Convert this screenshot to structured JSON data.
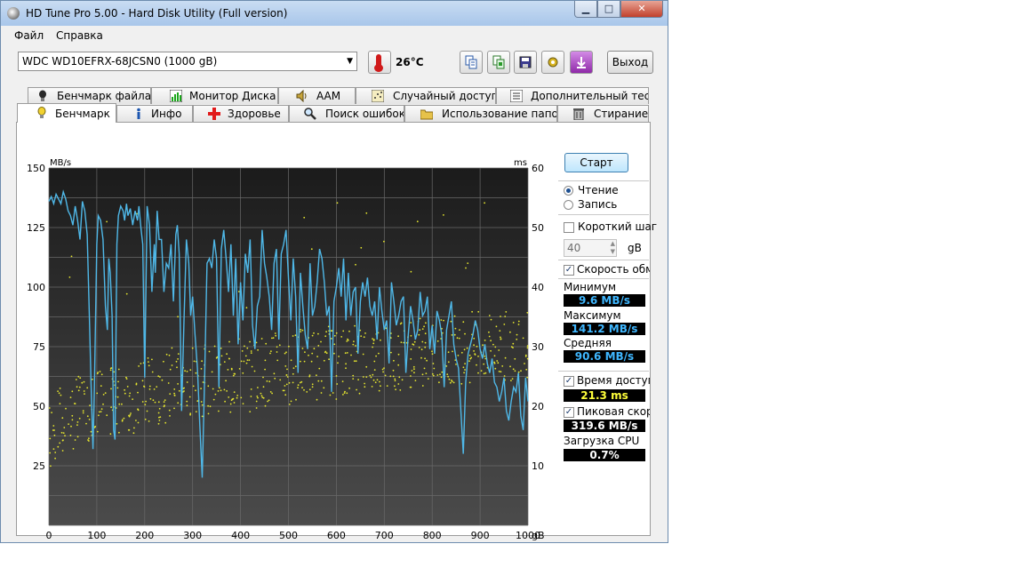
{
  "window": {
    "title": "HD Tune Pro 5.00 - Hard Disk Utility (Full  version)"
  },
  "menu": {
    "items": [
      "Файл",
      "Справка"
    ]
  },
  "toolbar": {
    "drive": "WDC WD10EFRX-68JCSN0 (1000 gB)",
    "temperature": "26°C",
    "exit_label": "Выход",
    "icons": [
      "thermometer-icon",
      "copy-text-icon",
      "copy-screenshot-icon",
      "save-icon",
      "settings-icon",
      "download-icon"
    ]
  },
  "tabs": {
    "row1": [
      "Бенчмарк файла",
      "Монитор Диска",
      "AAM",
      "Случайный доступ",
      "Дополнительный  тест"
    ],
    "row2": [
      "Бенчмарк",
      "Инфо",
      "Здоровье",
      "Поиск ошибок",
      "Использование папок",
      "Стирание"
    ],
    "active": "Бенчмарк"
  },
  "controls": {
    "start_label": "Старт",
    "read_label": "Чтение",
    "write_label": "Запись",
    "mode_selected": "read",
    "short_stroke_label": "Короткий шаг",
    "short_stroke_checked": false,
    "short_stroke_value": "40",
    "short_stroke_unit": "gB",
    "transfer_rate_label": "Скорость обмена",
    "transfer_rate_checked": true,
    "min_label": "Минимум",
    "min_value": "9.6 MB/s",
    "max_label": "Максимум",
    "max_value": "141.2 MB/s",
    "avg_label": "Средняя",
    "avg_value": "90.6 MB/s",
    "access_time_label": "Время доступа",
    "access_time_checked": true,
    "access_time_value": "21.3 ms",
    "burst_label": "Пиковая скорость",
    "burst_checked": true,
    "burst_value": "319.6 MB/s",
    "cpu_label": "Загрузка CPU",
    "cpu_value": "0.7%"
  },
  "colors": {
    "transfer_line": "#4fb8e8",
    "access_points": "#e6e62e",
    "stat_blue": "#3fb7ff",
    "stat_yellow": "#ffff3a",
    "stat_white": "#ffffff"
  },
  "chart_data": {
    "type": "line",
    "title": "",
    "y_left_unit": "MB/s",
    "y_right_unit": "ms",
    "y_left_ticks": [
      150,
      125,
      100,
      75,
      50,
      25
    ],
    "y_right_ticks": [
      60,
      50,
      40,
      30,
      20,
      10
    ],
    "x_ticks": [
      "0",
      "100",
      "200",
      "300",
      "400",
      "500",
      "600",
      "700",
      "800",
      "900",
      "1000"
    ],
    "x_unit": "gB",
    "ylim_left": [
      0,
      150
    ],
    "ylim_right": [
      0,
      60
    ],
    "xlim": [
      0,
      1000
    ],
    "series": [
      {
        "kind": "transfer_rate",
        "x": [
          0,
          5,
          10,
          15,
          20,
          25,
          30,
          35,
          40,
          45,
          50,
          55,
          60,
          65,
          70,
          75,
          80,
          85,
          88,
          92,
          95,
          100,
          103,
          108,
          113,
          118,
          122,
          125,
          128,
          132,
          135,
          138,
          142,
          145,
          150,
          155,
          158,
          162,
          165,
          170,
          175,
          180,
          185,
          188,
          192,
          196,
          200,
          205,
          210,
          215,
          220,
          222,
          226,
          230,
          235,
          240,
          245,
          250,
          255,
          260,
          265,
          268,
          272,
          277,
          282,
          287,
          292,
          296,
          300,
          305,
          310,
          315,
          320,
          325,
          330,
          335,
          340,
          345,
          350,
          355,
          360,
          365,
          370,
          375,
          380,
          385,
          390,
          395,
          400,
          405,
          410,
          415,
          420,
          425,
          430,
          435,
          440,
          445,
          450,
          455,
          460,
          465,
          470,
          475,
          480,
          485,
          490,
          495,
          500,
          505,
          510,
          515,
          520,
          525,
          530,
          535,
          540,
          545,
          550,
          555,
          560,
          565,
          570,
          575,
          580,
          585,
          590,
          595,
          600,
          605,
          610,
          615,
          620,
          625,
          630,
          635,
          640,
          645,
          650,
          655,
          660,
          665,
          670,
          675,
          680,
          685,
          690,
          695,
          700,
          705,
          710,
          715,
          720,
          725,
          730,
          735,
          740,
          745,
          750,
          755,
          760,
          765,
          770,
          775,
          780,
          785,
          790,
          795,
          800,
          805,
          810,
          815,
          820,
          825,
          830,
          835,
          840,
          845,
          850,
          855,
          860,
          865,
          870,
          875,
          880,
          885,
          890,
          895,
          900,
          905,
          910,
          915,
          920,
          925,
          930,
          935,
          940,
          945,
          950,
          955,
          960,
          965,
          970,
          975,
          980,
          985,
          990,
          995,
          1000
        ],
        "values": [
          136,
          138,
          135,
          139,
          137,
          135,
          140,
          137,
          132,
          130,
          126,
          134,
          128,
          120,
          136,
          132,
          122,
          84,
          60,
          32,
          58,
          118,
          130,
          128,
          120,
          92,
          82,
          112,
          106,
          88,
          40,
          36,
          118,
          130,
          134,
          132,
          128,
          135,
          130,
          133,
          126,
          132,
          128,
          134,
          125,
          118,
          62,
          134,
          126,
          98,
          118,
          106,
          132,
          120,
          120,
          98,
          110,
          108,
          118,
          94,
          122,
          126,
          114,
          48,
          86,
          120,
          110,
          88,
          96,
          80,
          66,
          42,
          20,
          62,
          110,
          112,
          108,
          120,
          112,
          58,
          116,
          124,
          112,
          98,
          118,
          88,
          112,
          76,
          102,
          86,
          114,
          106,
          120,
          84,
          74,
          92,
          96,
          124,
          110,
          104,
          96,
          82,
          110,
          116,
          78,
          114,
          118,
          124,
          104,
          86,
          112,
          96,
          64,
          106,
          92,
          80,
          74,
          110,
          88,
          92,
          102,
          116,
          112,
          102,
          88,
          92,
          56,
          94,
          100,
          108,
          96,
          112,
          86,
          106,
          88,
          98,
          100,
          72,
          94,
          102,
          96,
          104,
          92,
          88,
          94,
          78,
          100,
          90,
          82,
          86,
          68,
          102,
          94,
          84,
          88,
          94,
          96,
          64,
          80,
          92,
          86,
          78,
          82,
          98,
          88,
          90,
          96,
          74,
          84,
          72,
          90,
          86,
          80,
          58,
          82,
          88,
          94,
          76,
          70,
          66,
          48,
          30,
          60,
          72,
          76,
          80,
          86,
          82,
          74,
          70,
          76,
          68,
          64,
          70,
          60,
          58,
          52,
          56,
          62,
          48,
          44,
          52,
          58,
          56,
          64,
          46,
          40,
          62,
          52
        ]
      },
      {
        "kind": "access_time",
        "axis": "right",
        "description_of_distribution": "scatter",
        "x_sample": [
          0,
          20,
          40,
          60,
          80,
          100,
          120,
          140,
          160,
          180,
          200,
          220,
          240,
          260,
          280,
          300,
          320,
          340,
          360,
          380,
          400,
          420,
          440,
          460,
          480,
          500,
          520,
          540,
          560,
          580,
          600,
          620,
          640,
          660,
          680,
          700,
          720,
          740,
          760,
          780,
          800,
          820,
          840,
          860,
          880,
          900,
          920,
          940,
          960,
          980,
          1000
        ],
        "values_sample": [
          15,
          17,
          18,
          19,
          20,
          21,
          20,
          21,
          22,
          21,
          22,
          23,
          23,
          24,
          23,
          24,
          24,
          25,
          25,
          25,
          26,
          25,
          26,
          26,
          27,
          26,
          27,
          27,
          27,
          28,
          27,
          28,
          28,
          28,
          28,
          29,
          28,
          29,
          29,
          29,
          29,
          29,
          30,
          29,
          30,
          30,
          30,
          30,
          30,
          31,
          30
        ]
      }
    ],
    "grid": true
  }
}
